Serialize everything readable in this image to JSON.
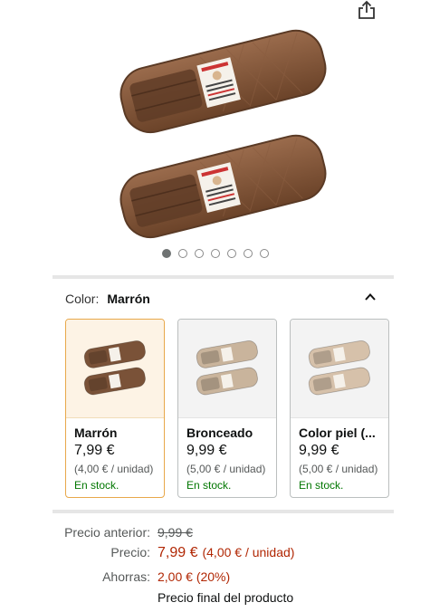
{
  "toolbar": {
    "share_icon": "share-icon"
  },
  "carousel": {
    "image_count": 7,
    "active_index": 0
  },
  "color": {
    "label": "Color:",
    "selected": "Marrón",
    "toggle_icon": "chevron-up-icon"
  },
  "variants": [
    {
      "name": "Marrón",
      "price": "7,99 €",
      "unit": "(4,00 € / unidad)",
      "stock": "En stock.",
      "color": "#7a5238",
      "selected": true
    },
    {
      "name": "Bronceado",
      "price": "9,99 €",
      "unit": "(5,00 € / unidad)",
      "stock": "En stock.",
      "color": "#c9b49c",
      "selected": false
    },
    {
      "name": "Color piel (...",
      "price": "9,99 €",
      "unit": "(5,00 € / unidad)",
      "stock": "En stock.",
      "color": "#d6c1aa",
      "selected": false
    }
  ],
  "pricing": {
    "previous_label": "Precio anterior:",
    "previous_value": "9,99 €",
    "price_label": "Precio:",
    "price_value": "7,99 €",
    "price_unit": "(4,00 € / unidad)",
    "savings_label": "Ahorras:",
    "savings_value": "2,00 € (20%)",
    "final_note": "Precio final del producto"
  },
  "colors": {
    "accent_selected": "#e8a84a",
    "price_red": "#b12704",
    "stock_green": "#007600"
  }
}
